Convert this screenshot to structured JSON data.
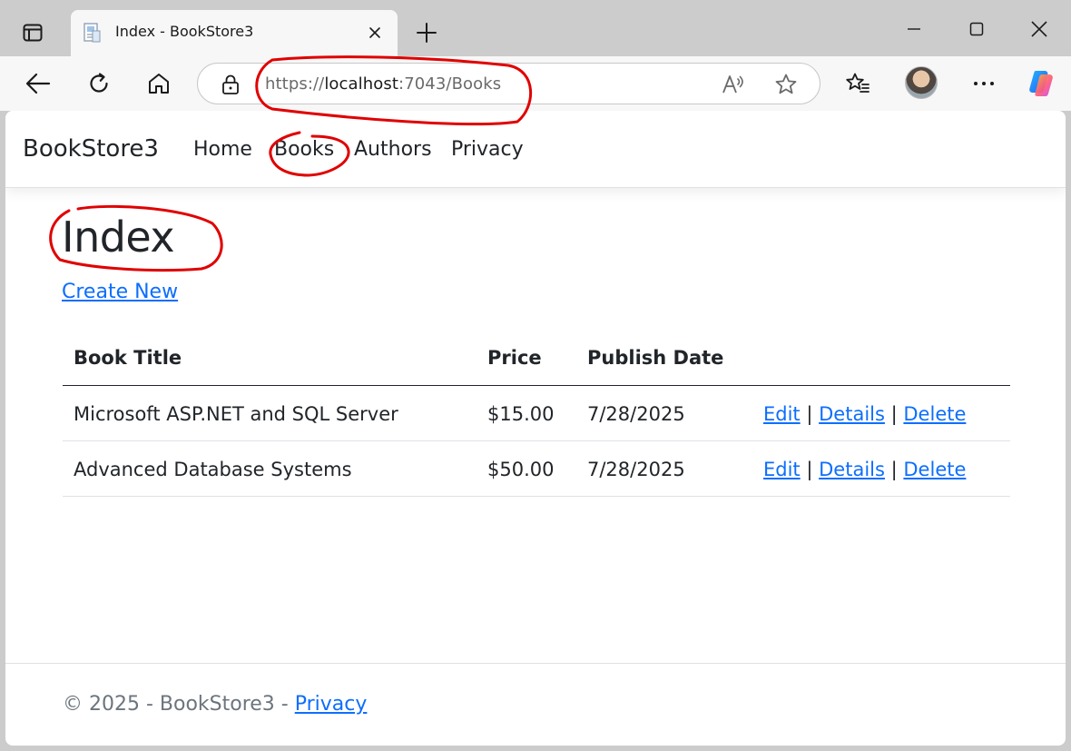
{
  "browser": {
    "tab_title": "Index - BookStore3",
    "url_scheme": "https://",
    "url_host": "localhost",
    "url_rest": ":7043/Books"
  },
  "site": {
    "brand": "BookStore3",
    "nav": [
      "Home",
      "Books",
      "Authors",
      "Privacy"
    ]
  },
  "page": {
    "title": "Index",
    "create_link": "Create New",
    "table": {
      "headers": [
        "Book Title",
        "Price",
        "Publish Date"
      ],
      "rows": [
        {
          "title": "Microsoft ASP.NET and SQL Server",
          "price": "$15.00",
          "date": "7/28/2025"
        },
        {
          "title": "Advanced Database Systems",
          "price": "$50.00",
          "date": "7/28/2025"
        }
      ],
      "actions": {
        "edit": "Edit",
        "details": "Details",
        "delete": "Delete",
        "separator": "|"
      }
    }
  },
  "footer": {
    "text": "© 2025 - BookStore3 - ",
    "privacy": "Privacy"
  },
  "colors": {
    "link": "#0d6efd",
    "text": "#212529",
    "annotation": "#e00000"
  }
}
